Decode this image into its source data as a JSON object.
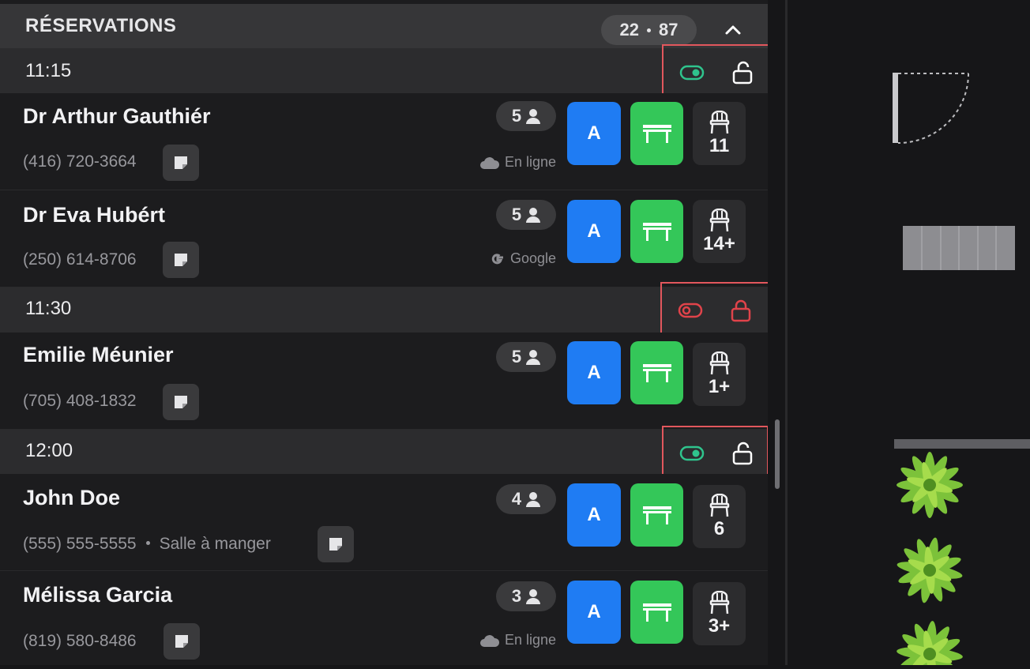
{
  "header": {
    "title": "RÉSERVATIONS",
    "count_left": "22",
    "count_right": "87"
  },
  "slots": [
    {
      "time": "11:15",
      "active": true
    },
    {
      "time": "11:30",
      "active": false
    },
    {
      "time": "12:00",
      "active": true
    }
  ],
  "reservations": [
    {
      "name": "Dr Arthur Gauthiér",
      "phone": "(416) 720-3664",
      "room": "",
      "party": "5",
      "source": "En ligne",
      "source_icon": "cloud-icon",
      "assign": "A",
      "seats": "11"
    },
    {
      "name": "Dr Eva Hubért",
      "phone": "(250) 614-8706",
      "room": "",
      "party": "5",
      "source": "Google",
      "source_icon": "google-icon",
      "assign": "A",
      "seats": "14+"
    },
    {
      "name": "Emilie Méunier",
      "phone": "(705) 408-1832",
      "room": "",
      "party": "5",
      "source": "",
      "source_icon": "",
      "assign": "A",
      "seats": "1+"
    },
    {
      "name": "John Doe",
      "phone": "(555) 555-5555",
      "room": "Salle à manger",
      "party": "4",
      "source": "",
      "source_icon": "",
      "assign": "A",
      "seats": "6"
    },
    {
      "name": "Mélissa Garcia",
      "phone": "(819) 580-8486",
      "room": "",
      "party": "3",
      "source": "En ligne",
      "source_icon": "cloud-icon",
      "assign": "A",
      "seats": "3+"
    }
  ],
  "colors": {
    "active_green": "#2fc48d",
    "inactive_red": "#e0434a",
    "highlight_box": "#e2575d",
    "assign_blue": "#1f7cf3",
    "table_green": "#34c759"
  }
}
